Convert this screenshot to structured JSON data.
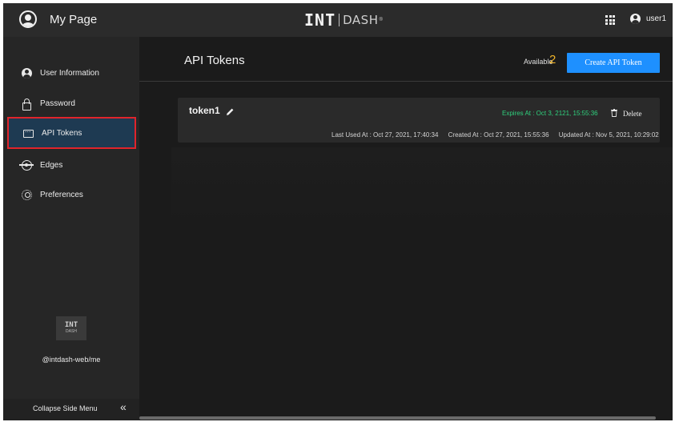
{
  "app": {
    "title": "My Page",
    "logo_int": "INT",
    "logo_dash": "DASH",
    "logo_reg": "®",
    "user": "user1"
  },
  "sidebar": {
    "items": [
      {
        "label": "User Information",
        "icon": "user-circle-icon"
      },
      {
        "label": "Password",
        "icon": "lock-icon"
      },
      {
        "label": "API Tokens",
        "icon": "token-icon",
        "active": true
      },
      {
        "label": "Edges",
        "icon": "edge-icon"
      },
      {
        "label": "Preferences",
        "icon": "gear-icon"
      }
    ],
    "logo_line1": "INT",
    "logo_line2": "DASH",
    "version": "@intdash-web/me",
    "collapse_label": "Collapse Side Menu",
    "collapse_icon": "«"
  },
  "main": {
    "title": "API Tokens",
    "available_label": "Available",
    "available_count": "2",
    "create_button": "Create API Token",
    "tokens": [
      {
        "name": "token1",
        "expires": "Expires At : Oct 3, 2121, 15:55:36",
        "delete_label": "Delete",
        "last_used": "Last Used At : Oct 27, 2021, 17:40:34",
        "created": "Created At : Oct 27, 2021, 15:55:36",
        "updated": "Updated At : Nov 5, 2021, 10:29:02"
      }
    ]
  },
  "colors": {
    "accent": "#1e90ff",
    "available": "#f0b429",
    "expires": "#2fd07d",
    "active_border": "#e0242b"
  }
}
